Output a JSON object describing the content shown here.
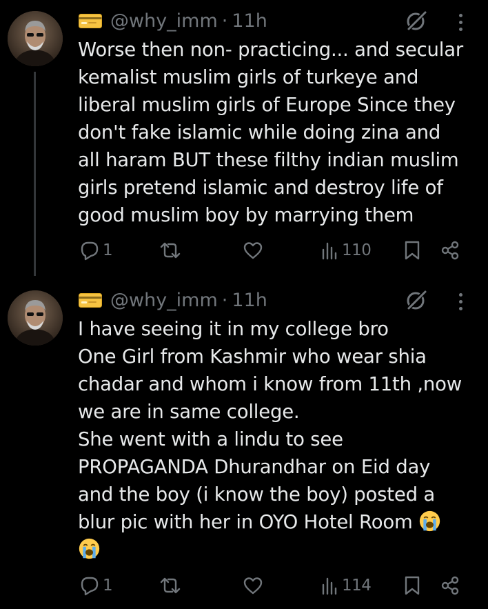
{
  "colors": {
    "background": "#000000",
    "text": "#e7e9ea",
    "secondary": "#71767b",
    "thread_line": "#333639"
  },
  "tweets": [
    {
      "handle": "@why_imm",
      "separator": "·",
      "time": "11h",
      "lines": [
        "Worse then non- practicing... and secular",
        "kemalist muslim girls of turkeye and",
        "liberal muslim girls of Europe Since they",
        "don't fake islamic while doing zina and",
        "all haram BUT these filthy indian muslim",
        "girls pretend islamic and destroy life of",
        "good muslim boy by marrying them"
      ],
      "replies": "1",
      "views": "110"
    },
    {
      "handle": "@why_imm",
      "separator": "·",
      "time": "11h",
      "lines": [
        "I have seeing it in my college bro",
        "One Girl from Kashmir who wear shia",
        "chadar and whom i know from 11th ,now",
        "we are in same college.",
        "She  went with a lindu to see",
        "PROPAGANDA Dhurandhar on Eid day",
        "and the boy (i know the boy) posted a",
        "blur pic with her in OYO Hotel Room"
      ],
      "replies": "1",
      "views": "114"
    }
  ],
  "icons": {
    "header_badge": "credit-card-icon",
    "grok": "grok-icon",
    "more": "more-icon",
    "reply": "reply-icon",
    "repost": "repost-icon",
    "like": "like-icon",
    "views": "views-icon",
    "bookmark": "bookmark-icon",
    "share": "share-icon",
    "emoji": "loudly-crying-face-emoji"
  }
}
